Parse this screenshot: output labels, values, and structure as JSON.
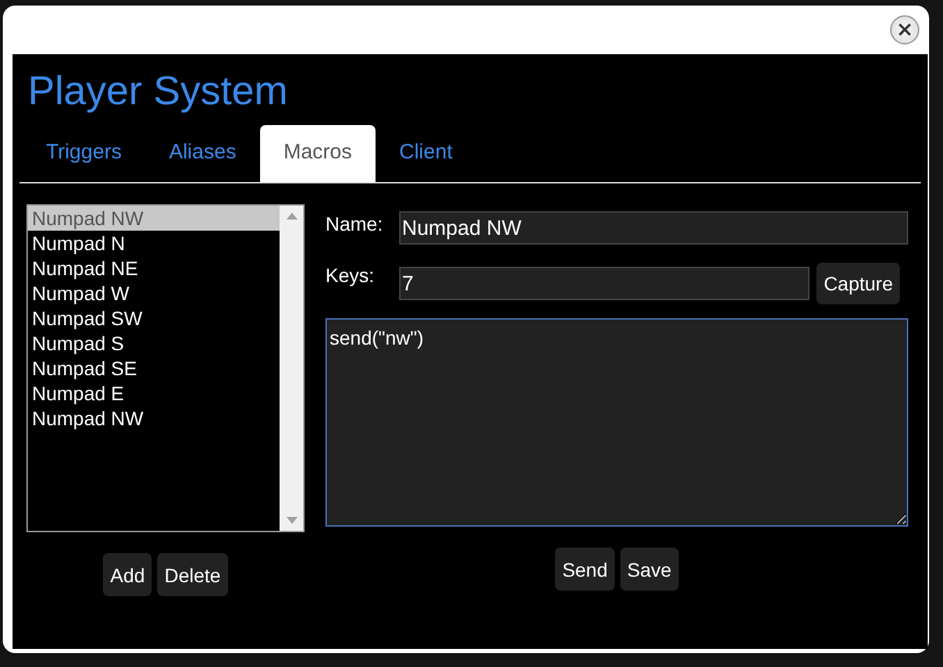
{
  "dialog": {
    "close": "×",
    "title": "Player System",
    "tabs": [
      {
        "label": "Triggers",
        "selected": false
      },
      {
        "label": "Aliases",
        "selected": false
      },
      {
        "label": "Macros",
        "selected": true
      },
      {
        "label": "Client",
        "selected": false
      }
    ],
    "macros": [
      {
        "label": "Numpad NW",
        "selected": true
      },
      {
        "label": "Numpad N",
        "selected": false
      },
      {
        "label": "Numpad NE",
        "selected": false
      },
      {
        "label": "Numpad W",
        "selected": false
      },
      {
        "label": "Numpad SW",
        "selected": false
      },
      {
        "label": "Numpad S",
        "selected": false
      },
      {
        "label": "Numpad SE",
        "selected": false
      },
      {
        "label": "Numpad E",
        "selected": false
      },
      {
        "label": "Numpad NW",
        "selected": false
      }
    ],
    "list_buttons": [
      "Add",
      "Delete"
    ],
    "name": {
      "label": "Name:",
      "value": "Numpad NW"
    },
    "keys": {
      "label": "Keys:",
      "value": "7",
      "button": "Capture"
    },
    "script": "send(\"nw\")",
    "editor_buttons": [
      "Send",
      "Save"
    ]
  }
}
